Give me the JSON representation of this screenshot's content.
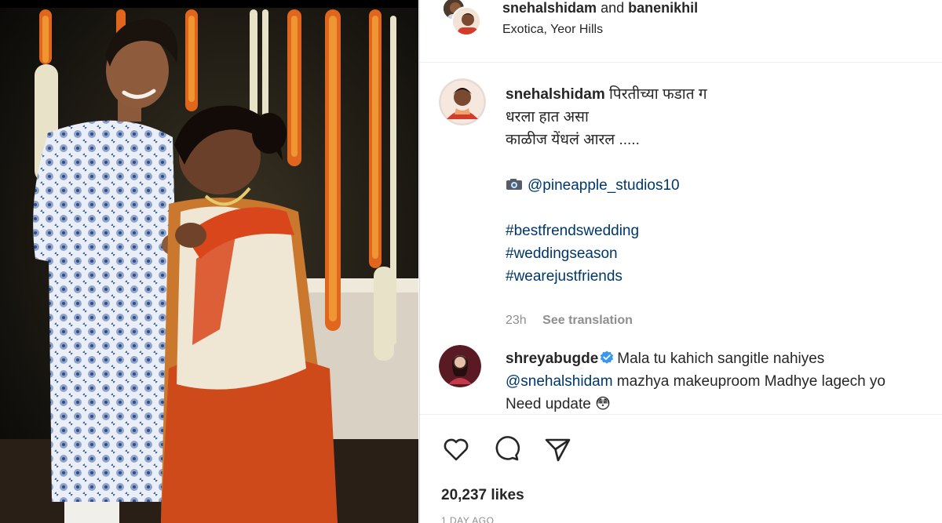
{
  "header": {
    "user1": "snehalshidam",
    "joiner": "and",
    "user2": "banenikhil",
    "location": "Exotica, Yeor Hills"
  },
  "caption": {
    "username": "snehalshidam",
    "line1": "पिरतीच्या फडात ग",
    "line2": "धरला हात असा",
    "line3": "काळीज येंधलं आरल .....",
    "camera_icon": "camera-icon",
    "credit": "@pineapple_studios10",
    "hashtags": [
      "#bestfrendswedding",
      "#weddingseason",
      "#wearejustfriends"
    ],
    "time": "23h",
    "see_translation": "See translation"
  },
  "comment": {
    "username": "shreyabugde",
    "line1": "Mala tu kahich sangitle nahiyes",
    "mention": "@snehalshidam",
    "line2_rest": " mazhya makeuproom Madhye lagech yo",
    "line3": "Need update",
    "emoji": "😳"
  },
  "actions": {
    "like_icon": "heart-icon",
    "comment_icon": "comment-icon",
    "share_icon": "share-icon"
  },
  "likes": "20,237 likes",
  "posted": "1 DAY AGO",
  "colors": {
    "link": "#00376b",
    "text": "#262626",
    "muted": "#8e8e8e",
    "verified": "#3897f0"
  }
}
